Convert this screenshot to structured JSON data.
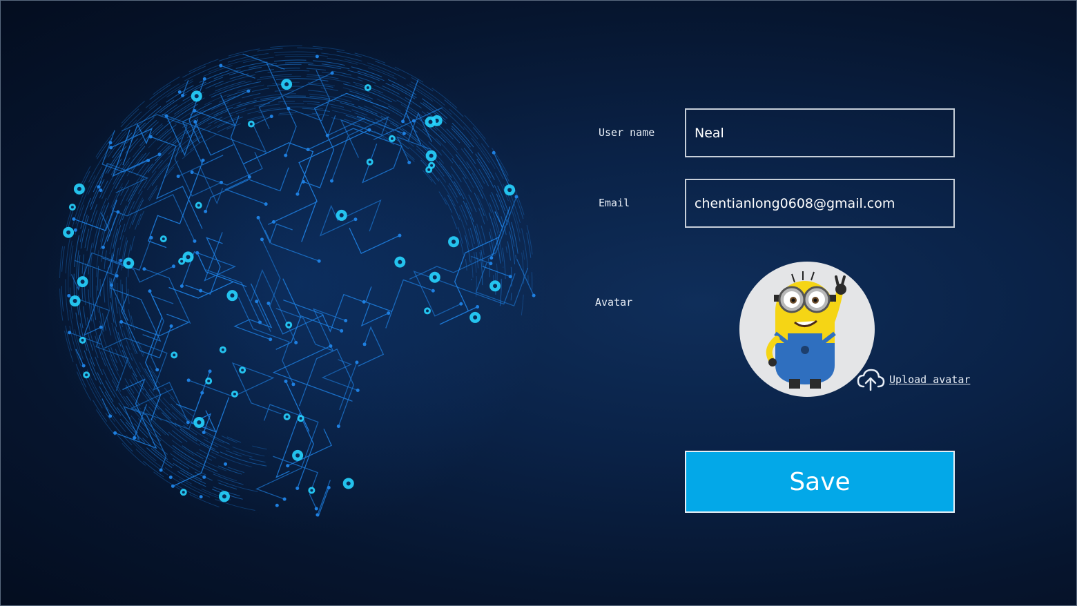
{
  "form": {
    "username_label": "User name",
    "username_value": "Neal",
    "email_label": "Email",
    "email_value": "chentianlong0608@gmail.com",
    "avatar_label": "Avatar",
    "upload_label": "Upload avatar",
    "save_label": "Save"
  },
  "colors": {
    "background": "#06152e",
    "accent": "#03a8e8",
    "globe_lines": "#1e7fe0",
    "globe_nodes": "#27d4ff"
  },
  "icons": {
    "upload": "cloud-upload-icon",
    "avatar": "minion-avatar-image"
  }
}
